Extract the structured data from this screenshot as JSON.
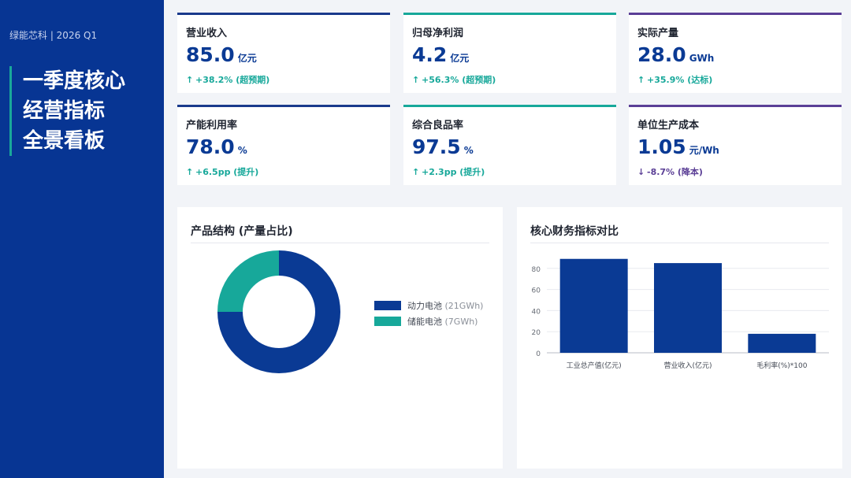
{
  "sidebar": {
    "brand": "绿能芯科 | 2026 Q1",
    "title_lines": [
      "一季度核心",
      "经营指标",
      "全景看板"
    ]
  },
  "colors": {
    "navy": "#0a3a94",
    "teal": "#17a89a",
    "purple": "#5b3f96",
    "up": "#17a89a",
    "down": "#5b3f96"
  },
  "kpis": [
    {
      "label": "营业收入",
      "value": "85.0",
      "unit": "亿元",
      "arrow": "↑",
      "delta": "+38.2% (超预期)",
      "accent": "#1a3a8c",
      "delta_color": "#17a89a"
    },
    {
      "label": "归母净利润",
      "value": "4.2",
      "unit": "亿元",
      "arrow": "↑",
      "delta": "+56.3% (超预期)",
      "accent": "#17a89a",
      "delta_color": "#17a89a"
    },
    {
      "label": "实际产量",
      "value": "28.0",
      "unit": "GWh",
      "arrow": "↑",
      "delta": "+35.9% (达标)",
      "accent": "#5b3f96",
      "delta_color": "#17a89a"
    },
    {
      "label": "产能利用率",
      "value": "78.0",
      "unit": "%",
      "arrow": "↑",
      "delta": "+6.5pp (提升)",
      "accent": "#1a3a8c",
      "delta_color": "#17a89a"
    },
    {
      "label": "综合良品率",
      "value": "97.5",
      "unit": "%",
      "arrow": "↑",
      "delta": "+2.3pp (提升)",
      "accent": "#17a89a",
      "delta_color": "#17a89a"
    },
    {
      "label": "单位生产成本",
      "value": "1.05",
      "unit": "元/Wh",
      "arrow": "↓",
      "delta": "-8.7% (降本)",
      "accent": "#5b3f96",
      "delta_color": "#5b3f96"
    }
  ],
  "panel_left": {
    "title": "产品结构 (产量占比)"
  },
  "panel_right": {
    "title": "核心财务指标对比"
  },
  "chart_data": [
    {
      "type": "pie",
      "donut": true,
      "title": "产品结构 (产量占比)",
      "slices": [
        {
          "label": "动力电池",
          "detail": "(21GWh)",
          "value": 21,
          "color": "#0a3a94"
        },
        {
          "label": "储能电池",
          "detail": "(7GWh)",
          "value": 7,
          "color": "#17a89a"
        }
      ],
      "legend": "right"
    },
    {
      "type": "bar",
      "title": "核心财务指标对比",
      "categories": [
        "工业总产值(亿元)",
        "营业收入(亿元)",
        "毛利率(%)*100"
      ],
      "values": [
        89,
        85,
        18
      ],
      "ylim": [
        0,
        90
      ],
      "yticks": [
        0,
        20,
        40,
        60,
        80
      ],
      "color": "#0a3a94",
      "grid": true
    }
  ]
}
